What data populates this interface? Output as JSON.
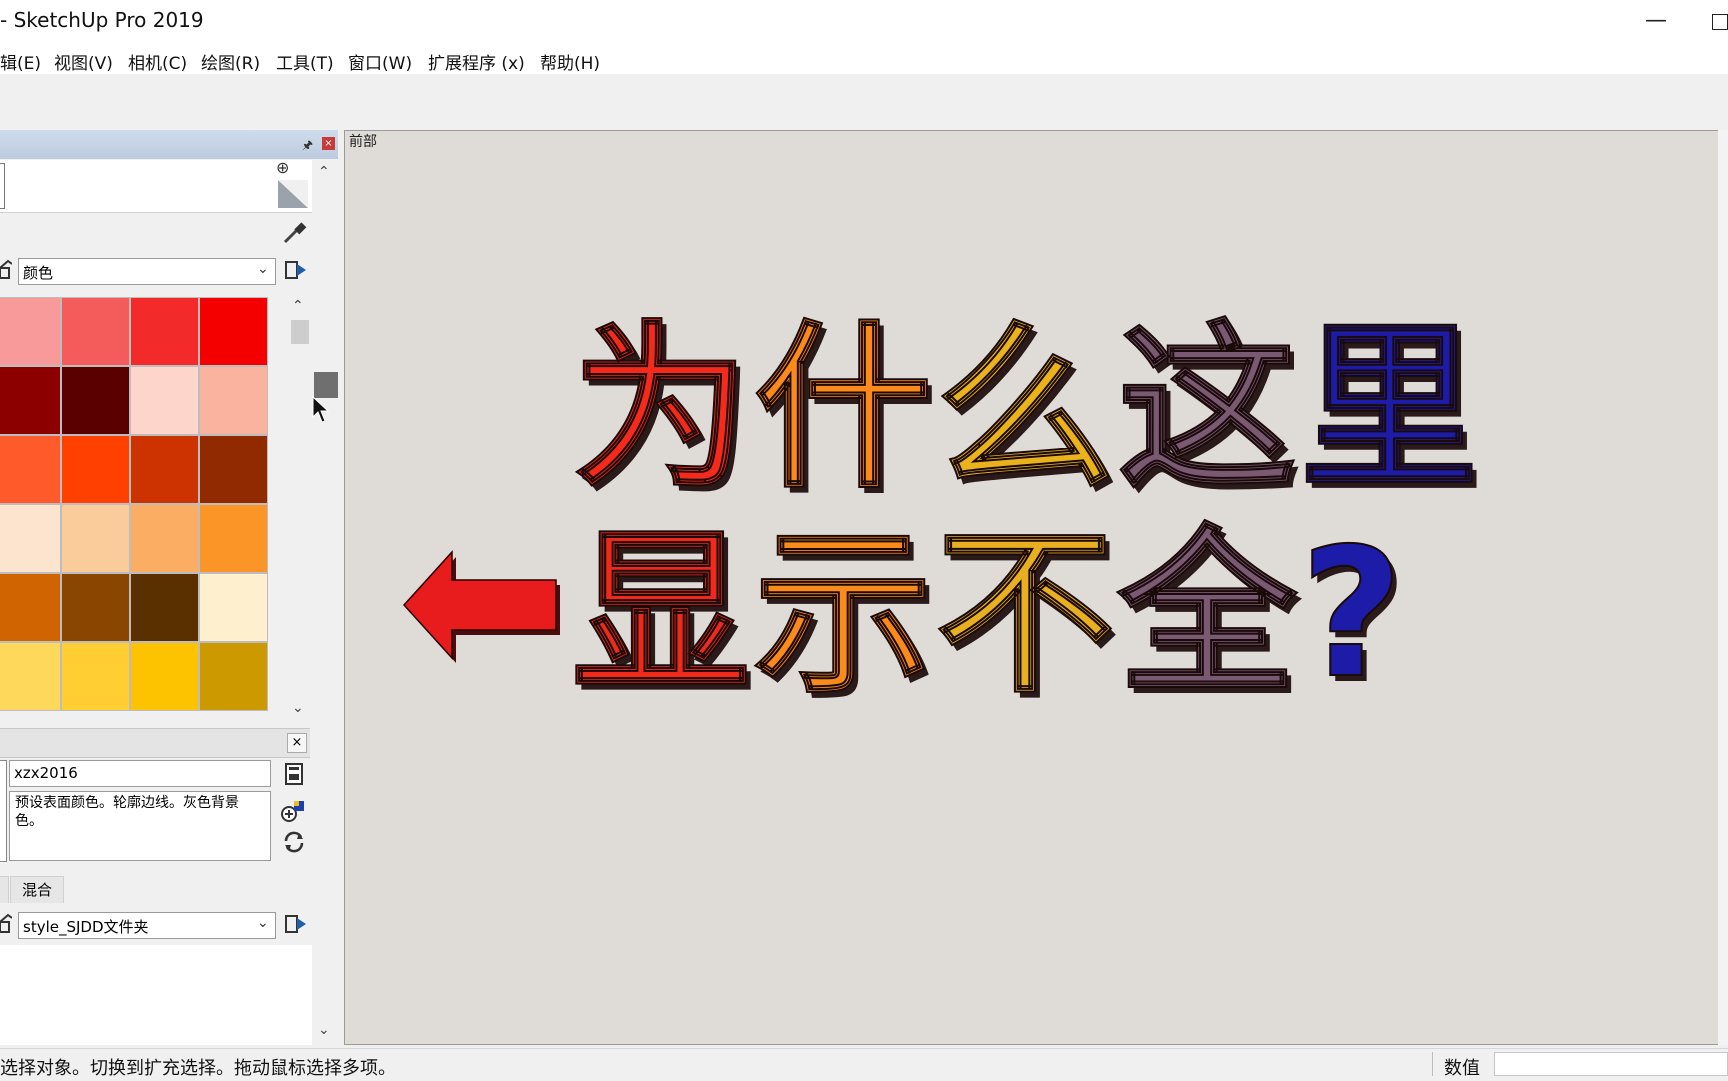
{
  "window": {
    "title": "- SketchUp Pro 2019",
    "minimize_glyph": "—"
  },
  "menu": {
    "items": [
      "辑(E)",
      "视图(V)",
      "相机(C)",
      "绘图(R)",
      "工具(T)",
      "窗口(W)",
      "扩展程序 (x)",
      "帮助(H)"
    ]
  },
  "panel": {
    "close_glyph": "×",
    "materials": {
      "collection": "颜色"
    },
    "swatches": [
      [
        "#f99a9a",
        "#f45b5b",
        "#f22a2a",
        "#f50000"
      ],
      [
        "#8c0000",
        "#5a0000",
        "#fdd5cb",
        "#f9b39f"
      ],
      [
        "#ff5b2a",
        "#ff4000",
        "#cc3300",
        "#922a00"
      ],
      [
        "#fde4cf",
        "#fbcc9b",
        "#fbae63",
        "#fb9528"
      ],
      [
        "#d06400",
        "#8a4500",
        "#5a3000",
        "#fef0cf"
      ],
      [
        "#fed85b",
        "#fece32",
        "#fec300",
        "#cc9900"
      ]
    ],
    "style": {
      "name": "xzx2016",
      "description": "预设表面颜色。轮廓边线。灰色背景色。",
      "tab": "混合",
      "collection": "style_SJDD文件夹",
      "close_glyph": "×"
    }
  },
  "viewport": {
    "scene_label": "前部",
    "headline_line1": [
      "为",
      "什",
      "么",
      "这",
      "里"
    ],
    "headline_line2": [
      "显",
      "示",
      "不",
      "全",
      "?"
    ],
    "line1_colors": [
      "#f52a1a",
      "#fb8a1a",
      "#eab31c",
      "#7a5a72",
      "#1c1ca8"
    ],
    "line2_colors": [
      "#f02a1a",
      "#fa8a1a",
      "#e8b020",
      "#7a5a72",
      "#1c1ca8"
    ],
    "arrow_color": "#e81c1c"
  },
  "status": {
    "hint": "选择对象。切换到扩充选择。拖动鼠标选择多项。",
    "measure_label": "数值",
    "measure_value": ""
  }
}
